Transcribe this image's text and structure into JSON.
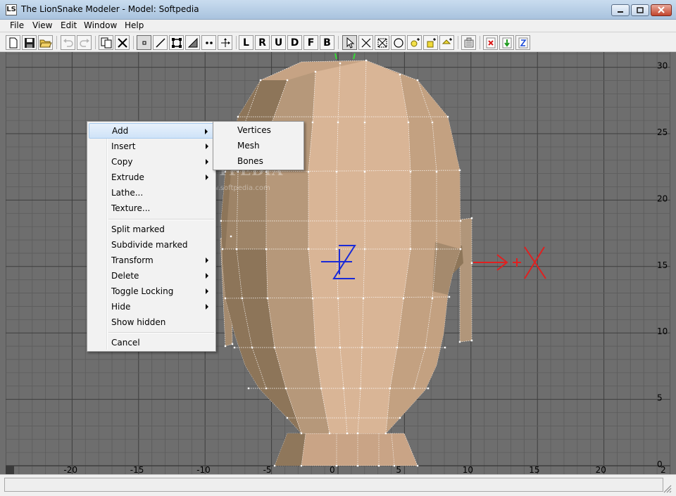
{
  "window": {
    "icon_text": "LS",
    "title": "The LionSnake Modeler - Model: Softpedia",
    "controls": [
      "minimize",
      "restore",
      "close"
    ]
  },
  "menubar": [
    "File",
    "View",
    "Edit",
    "Window",
    "Help"
  ],
  "toolbar": {
    "view_letters": [
      "L",
      "R",
      "U",
      "D",
      "F",
      "B"
    ],
    "icons": [
      "new-file-icon",
      "save-icon",
      "open-folder-icon",
      "undo-icon",
      "redo-icon",
      "copy-icon",
      "cut-x-icon",
      "vertex-mode-icon",
      "edge-mode-icon",
      "face-mode-icon",
      "mesh-mode-icon",
      "bone-mode-icon",
      "move-axes-icon",
      "select-arrow-icon",
      "scale-x-icon",
      "box-select-icon",
      "circle-select-icon",
      "light-icon",
      "light-add-icon",
      "lamp-icon",
      "properties-icon",
      "delete-x-icon",
      "down-arrow-icon",
      "z-axis-icon"
    ]
  },
  "viewport": {
    "x_axis_labels": [
      "-20",
      "-15",
      "-10",
      "-5",
      "0",
      "5",
      "10",
      "15",
      "20",
      "2"
    ],
    "y_axis_labels": [
      "30",
      "25",
      "20",
      "15",
      "10",
      "5",
      "0"
    ],
    "watermark": "SOFTPEDIA",
    "watermark_url": "www.softpedia.com",
    "colors": {
      "background": "#6e6e6e",
      "grid": "#3e3e3e",
      "mesh_light": "#d8b393",
      "mesh_mid": "#b89a7b",
      "mesh_dark": "#8a7358",
      "gizmo_z": "#1a2ad8",
      "gizmo_x": "#e02020"
    }
  },
  "context_menu": {
    "items": [
      {
        "label": "Add",
        "submenu": true,
        "highlighted": true
      },
      {
        "label": "Insert",
        "submenu": true
      },
      {
        "label": "Copy",
        "submenu": true
      },
      {
        "label": "Extrude",
        "submenu": true
      },
      {
        "label": "Lathe...",
        "submenu": false
      },
      {
        "label": "Texture...",
        "submenu": false
      },
      {
        "separator": true
      },
      {
        "label": "Split marked",
        "submenu": false
      },
      {
        "label": "Subdivide marked",
        "submenu": false
      },
      {
        "label": "Transform",
        "submenu": true
      },
      {
        "label": "Delete",
        "submenu": true
      },
      {
        "label": "Toggle Locking",
        "submenu": true
      },
      {
        "label": "Hide",
        "submenu": true
      },
      {
        "label": "Show hidden",
        "submenu": false
      },
      {
        "separator": true
      },
      {
        "label": "Cancel",
        "submenu": false
      }
    ]
  },
  "submenu": {
    "parent": "Add",
    "items": [
      "Vertices",
      "Mesh",
      "Bones"
    ]
  }
}
